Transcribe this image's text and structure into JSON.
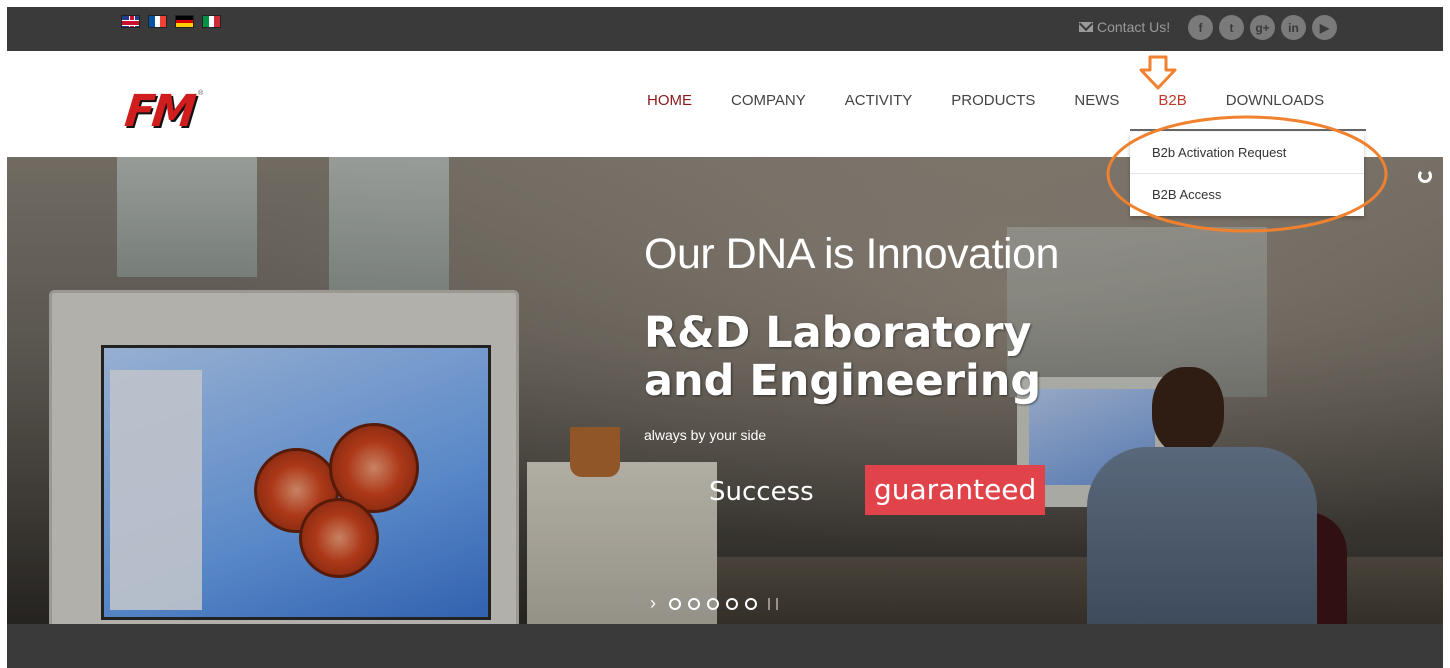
{
  "topbar": {
    "languages": [
      "English",
      "Français",
      "Deutsch",
      "Italiano"
    ],
    "contact_label": "Contact Us!",
    "socials": [
      {
        "icon": "facebook-icon",
        "glyph": "f"
      },
      {
        "icon": "twitter-icon",
        "glyph": "t"
      },
      {
        "icon": "google-plus-icon",
        "glyph": "g+"
      },
      {
        "icon": "linkedin-icon",
        "glyph": "in"
      },
      {
        "icon": "youtube-icon",
        "glyph": "▶"
      }
    ]
  },
  "header": {
    "logo_text": "FM",
    "logo_reg": "®",
    "nav": [
      {
        "label": "HOME",
        "state": "active"
      },
      {
        "label": "COMPANY"
      },
      {
        "label": "ACTIVITY"
      },
      {
        "label": "PRODUCTS"
      },
      {
        "label": "NEWS"
      },
      {
        "label": "B2B",
        "state": "hover"
      },
      {
        "label": "DOWNLOADS"
      }
    ]
  },
  "dropdown": {
    "items": [
      "B2b Activation Request",
      "B2B Access"
    ]
  },
  "hero": {
    "line1": "Our DNA is Innovation",
    "line2a": "R&D Laboratory",
    "line2b": "and Engineering",
    "line3": "always by your side",
    "success": "Success",
    "guaranteed": "guaranteed",
    "slide_count": 5
  },
  "colors": {
    "topbar": "#3a3a3a",
    "nav_active": "#8b1a1a",
    "annotation": "#f0812e",
    "badge_red": "#e0434a",
    "logo_red": "#d01e1e"
  }
}
